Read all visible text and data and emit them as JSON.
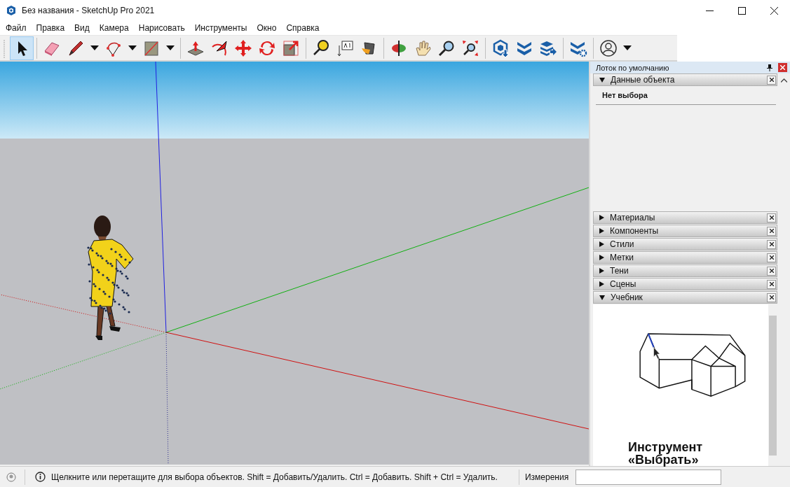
{
  "window": {
    "title": "Без названия - SketchUp Pro 2021"
  },
  "menu": [
    "Файл",
    "Правка",
    "Вид",
    "Камера",
    "Нарисовать",
    "Инструменты",
    "Окно",
    "Справка"
  ],
  "toolbar": [
    [
      {
        "kind": "select",
        "selected": true,
        "dropdown": false
      }
    ],
    [
      {
        "kind": "eraser",
        "selected": false,
        "dropdown": false
      },
      {
        "kind": "pencil",
        "selected": false,
        "dropdown": true
      },
      {
        "kind": "arc",
        "selected": false,
        "dropdown": true
      },
      {
        "kind": "rectangle",
        "selected": false,
        "dropdown": true
      }
    ],
    [
      {
        "kind": "pushpull",
        "selected": false,
        "dropdown": false
      },
      {
        "kind": "followme",
        "selected": false,
        "dropdown": false
      },
      {
        "kind": "move",
        "selected": false,
        "dropdown": false
      },
      {
        "kind": "rotate",
        "selected": false,
        "dropdown": false
      },
      {
        "kind": "scale",
        "selected": false,
        "dropdown": false
      }
    ],
    [
      {
        "kind": "tape",
        "selected": false,
        "dropdown": false
      },
      {
        "kind": "text",
        "selected": false,
        "dropdown": false
      },
      {
        "kind": "paint",
        "selected": false,
        "dropdown": false
      }
    ],
    [
      {
        "kind": "orbit",
        "selected": false,
        "dropdown": false
      },
      {
        "kind": "pan",
        "selected": false,
        "dropdown": false
      },
      {
        "kind": "zoom",
        "selected": false,
        "dropdown": false
      },
      {
        "kind": "zoomext",
        "selected": false,
        "dropdown": false
      }
    ],
    [
      {
        "kind": "warehouse",
        "selected": false,
        "dropdown": false
      },
      {
        "kind": "extensions",
        "selected": false,
        "dropdown": false
      },
      {
        "kind": "send",
        "selected": false,
        "dropdown": false
      }
    ],
    [
      {
        "kind": "extmanager",
        "selected": false,
        "dropdown": false
      }
    ],
    [
      {
        "kind": "account",
        "selected": false,
        "dropdown": true
      }
    ]
  ],
  "tray": {
    "title": "Лоток по умолчанию",
    "sections": [
      {
        "title": "Данные объекта",
        "expanded": true,
        "content": {
          "kind": "entity_info",
          "text": "Нет выбора"
        }
      },
      {
        "title": "Материалы",
        "expanded": false
      },
      {
        "title": "Компоненты",
        "expanded": false
      },
      {
        "title": "Стили",
        "expanded": false
      },
      {
        "title": "Метки",
        "expanded": false
      },
      {
        "title": "Тени",
        "expanded": false
      },
      {
        "title": "Сцены",
        "expanded": false
      },
      {
        "title": "Учебник",
        "expanded": true,
        "content": {
          "kind": "tutorial",
          "title": "Инструмент «Выбрать»"
        }
      }
    ]
  },
  "status_bar": {
    "hint": "Щелкните или перетащите для выбора объектов. Shift = Добавить/Удалить. Ctrl = Добавить. Shift + Ctrl = Удалить.",
    "measurements_label": "Измерения"
  }
}
